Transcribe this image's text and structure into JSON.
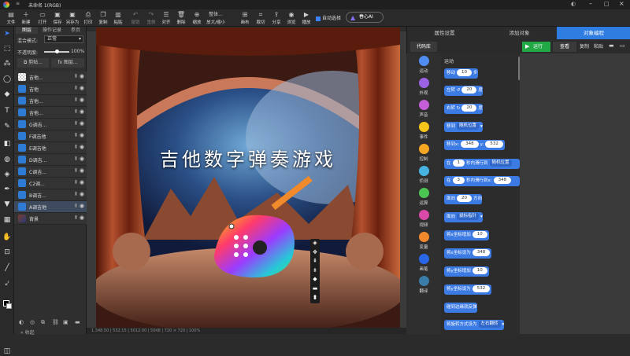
{
  "titlebar": {
    "doc_title": "未命名 1(RGB)"
  },
  "toolbar": {
    "items": [
      "文件",
      "新建",
      "打开",
      "保存",
      "另存为",
      "打印",
      "复制",
      "粘贴",
      "撤销",
      "重做",
      "对齐",
      "删除",
      "缩放",
      "放大/缩小",
      "画布",
      "裁切",
      "分享",
      "浏览",
      "播放"
    ],
    "zoom_label": "整体...",
    "autoselect": "自动选择",
    "ai_label": "春心AI"
  },
  "layers": {
    "tabs": [
      "图层",
      "操作记录",
      "参页"
    ],
    "blend_label": "混合模式:",
    "blend_value": "正常",
    "opacity_label": "不透明度:",
    "opacity_value": "100%",
    "clip_btn": "剪贴...",
    "fx_btn": "图层...",
    "items": [
      "吉他...",
      "吉他",
      "吉他...",
      "吉他...",
      "G调吉...",
      "F调吉他",
      "E调吉他",
      "D调吉...",
      "C调吉...",
      "C2调...",
      "B调吉...",
      "A调吉他",
      "背景"
    ],
    "footer": "收起"
  },
  "canvas": {
    "title": "吉他数字弹奏游戏"
  },
  "status": {
    "text": "1.348.50 | 532.15 | 5012.00 | 5048 | 720 × 720 | 100%"
  },
  "right": {
    "tabs": [
      "属性设置",
      "添加对象",
      "对象编程"
    ],
    "lib_tab": "代码库",
    "run": "运行",
    "view": "查看",
    "copy": "复制",
    "paste": "粘贴",
    "section": "运动",
    "categories": [
      {
        "label": "运动",
        "color": "#4f8ef0"
      },
      {
        "label": "外观",
        "color": "#9b62e6"
      },
      {
        "label": "声音",
        "color": "#c35ed8"
      },
      {
        "label": "事件",
        "color": "#f7c51a"
      },
      {
        "label": "控制",
        "color": "#f5a623"
      },
      {
        "label": "侦测",
        "color": "#48b3e0"
      },
      {
        "label": "运算",
        "color": "#4cc653"
      },
      {
        "label": "视频",
        "color": "#d94aa8"
      },
      {
        "label": "变量",
        "color": "#f0892b"
      },
      {
        "label": "画笔",
        "color": "#2a66e8"
      },
      {
        "label": "翻译",
        "color": "#3a7da8"
      }
    ],
    "blocks": {
      "move": {
        "a": "移动",
        "v": "10",
        "b": "步"
      },
      "turn_l": {
        "a": "左转",
        "v": "20",
        "b": "度"
      },
      "turn_r": {
        "a": "右转",
        "v": "20",
        "b": "度"
      },
      "goto": {
        "a": "移到",
        "s": "随机位置"
      },
      "goto_xy": {
        "a": "移到x:",
        "x": "348",
        "m": "y:",
        "y": "532"
      },
      "glide1": {
        "a": "在",
        "v": "1",
        "b": "秒内滑行到",
        "s": "随机位置"
      },
      "glide2": {
        "a": "在",
        "v": "3",
        "b": "秒内滑行到x:",
        "x": "348"
      },
      "face": {
        "a": "面向",
        "v": "20",
        "b": "方向"
      },
      "face_to": {
        "a": "面向",
        "s": "鼠标指针"
      },
      "chx": {
        "a": "将x坐标增加",
        "v": "10"
      },
      "setx": {
        "a": "将x坐标设为",
        "v": "348"
      },
      "chy": {
        "a": "将y坐标增加",
        "v": "10"
      },
      "sety": {
        "a": "将y坐标设为",
        "v": "532"
      },
      "bounce": {
        "a": "碰到边缘就反弹"
      },
      "rot": {
        "a": "将旋转方式设为",
        "s": "左右翻转"
      }
    }
  }
}
